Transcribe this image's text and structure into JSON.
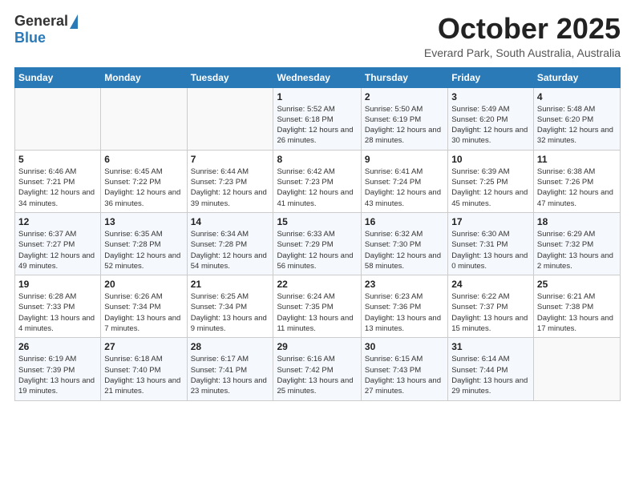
{
  "header": {
    "logo_general": "General",
    "logo_blue": "Blue",
    "month": "October 2025",
    "location": "Everard Park, South Australia, Australia"
  },
  "weekdays": [
    "Sunday",
    "Monday",
    "Tuesday",
    "Wednesday",
    "Thursday",
    "Friday",
    "Saturday"
  ],
  "weeks": [
    [
      {
        "day": "",
        "info": ""
      },
      {
        "day": "",
        "info": ""
      },
      {
        "day": "",
        "info": ""
      },
      {
        "day": "1",
        "info": "Sunrise: 5:52 AM\nSunset: 6:18 PM\nDaylight: 12 hours\nand 26 minutes."
      },
      {
        "day": "2",
        "info": "Sunrise: 5:50 AM\nSunset: 6:19 PM\nDaylight: 12 hours\nand 28 minutes."
      },
      {
        "day": "3",
        "info": "Sunrise: 5:49 AM\nSunset: 6:20 PM\nDaylight: 12 hours\nand 30 minutes."
      },
      {
        "day": "4",
        "info": "Sunrise: 5:48 AM\nSunset: 6:20 PM\nDaylight: 12 hours\nand 32 minutes."
      }
    ],
    [
      {
        "day": "5",
        "info": "Sunrise: 6:46 AM\nSunset: 7:21 PM\nDaylight: 12 hours\nand 34 minutes."
      },
      {
        "day": "6",
        "info": "Sunrise: 6:45 AM\nSunset: 7:22 PM\nDaylight: 12 hours\nand 36 minutes."
      },
      {
        "day": "7",
        "info": "Sunrise: 6:44 AM\nSunset: 7:23 PM\nDaylight: 12 hours\nand 39 minutes."
      },
      {
        "day": "8",
        "info": "Sunrise: 6:42 AM\nSunset: 7:23 PM\nDaylight: 12 hours\nand 41 minutes."
      },
      {
        "day": "9",
        "info": "Sunrise: 6:41 AM\nSunset: 7:24 PM\nDaylight: 12 hours\nand 43 minutes."
      },
      {
        "day": "10",
        "info": "Sunrise: 6:39 AM\nSunset: 7:25 PM\nDaylight: 12 hours\nand 45 minutes."
      },
      {
        "day": "11",
        "info": "Sunrise: 6:38 AM\nSunset: 7:26 PM\nDaylight: 12 hours\nand 47 minutes."
      }
    ],
    [
      {
        "day": "12",
        "info": "Sunrise: 6:37 AM\nSunset: 7:27 PM\nDaylight: 12 hours\nand 49 minutes."
      },
      {
        "day": "13",
        "info": "Sunrise: 6:35 AM\nSunset: 7:28 PM\nDaylight: 12 hours\nand 52 minutes."
      },
      {
        "day": "14",
        "info": "Sunrise: 6:34 AM\nSunset: 7:28 PM\nDaylight: 12 hours\nand 54 minutes."
      },
      {
        "day": "15",
        "info": "Sunrise: 6:33 AM\nSunset: 7:29 PM\nDaylight: 12 hours\nand 56 minutes."
      },
      {
        "day": "16",
        "info": "Sunrise: 6:32 AM\nSunset: 7:30 PM\nDaylight: 12 hours\nand 58 minutes."
      },
      {
        "day": "17",
        "info": "Sunrise: 6:30 AM\nSunset: 7:31 PM\nDaylight: 13 hours\nand 0 minutes."
      },
      {
        "day": "18",
        "info": "Sunrise: 6:29 AM\nSunset: 7:32 PM\nDaylight: 13 hours\nand 2 minutes."
      }
    ],
    [
      {
        "day": "19",
        "info": "Sunrise: 6:28 AM\nSunset: 7:33 PM\nDaylight: 13 hours\nand 4 minutes."
      },
      {
        "day": "20",
        "info": "Sunrise: 6:26 AM\nSunset: 7:34 PM\nDaylight: 13 hours\nand 7 minutes."
      },
      {
        "day": "21",
        "info": "Sunrise: 6:25 AM\nSunset: 7:34 PM\nDaylight: 13 hours\nand 9 minutes."
      },
      {
        "day": "22",
        "info": "Sunrise: 6:24 AM\nSunset: 7:35 PM\nDaylight: 13 hours\nand 11 minutes."
      },
      {
        "day": "23",
        "info": "Sunrise: 6:23 AM\nSunset: 7:36 PM\nDaylight: 13 hours\nand 13 minutes."
      },
      {
        "day": "24",
        "info": "Sunrise: 6:22 AM\nSunset: 7:37 PM\nDaylight: 13 hours\nand 15 minutes."
      },
      {
        "day": "25",
        "info": "Sunrise: 6:21 AM\nSunset: 7:38 PM\nDaylight: 13 hours\nand 17 minutes."
      }
    ],
    [
      {
        "day": "26",
        "info": "Sunrise: 6:19 AM\nSunset: 7:39 PM\nDaylight: 13 hours\nand 19 minutes."
      },
      {
        "day": "27",
        "info": "Sunrise: 6:18 AM\nSunset: 7:40 PM\nDaylight: 13 hours\nand 21 minutes."
      },
      {
        "day": "28",
        "info": "Sunrise: 6:17 AM\nSunset: 7:41 PM\nDaylight: 13 hours\nand 23 minutes."
      },
      {
        "day": "29",
        "info": "Sunrise: 6:16 AM\nSunset: 7:42 PM\nDaylight: 13 hours\nand 25 minutes."
      },
      {
        "day": "30",
        "info": "Sunrise: 6:15 AM\nSunset: 7:43 PM\nDaylight: 13 hours\nand 27 minutes."
      },
      {
        "day": "31",
        "info": "Sunrise: 6:14 AM\nSunset: 7:44 PM\nDaylight: 13 hours\nand 29 minutes."
      },
      {
        "day": "",
        "info": ""
      }
    ]
  ]
}
